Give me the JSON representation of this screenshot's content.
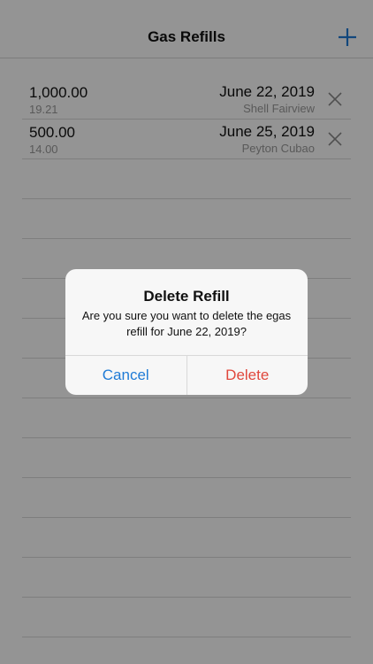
{
  "navbar": {
    "title": "Gas Refills",
    "add_icon": "plus-icon",
    "accent_color": "#1f7bd6"
  },
  "refills": [
    {
      "amount": "1,000.00",
      "liters": "19.21",
      "date": "June 22, 2019",
      "station": "Shell Fairview"
    },
    {
      "amount": "500.00",
      "liters": "14.00",
      "date": "June 25, 2019",
      "station": "Peyton Cubao"
    }
  ],
  "row_delete_icon": "close-icon",
  "alert": {
    "title": "Delete Refill",
    "message": "Are you sure you want to delete the egas refill for June 22, 2019?",
    "cancel_label": "Cancel",
    "delete_label": "Delete",
    "delete_color": "#e0473c"
  }
}
